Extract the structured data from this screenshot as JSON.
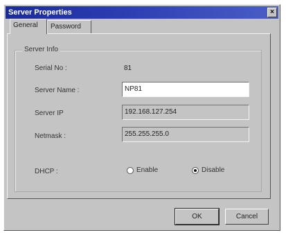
{
  "window": {
    "title": "Server Properties",
    "close_glyph": "×"
  },
  "tabs": [
    {
      "label": "General",
      "selected": true
    },
    {
      "label": "Password",
      "selected": false
    }
  ],
  "server_info": {
    "group_label": "Server Info",
    "serial_label": "Serial No :",
    "serial_value": "81",
    "name_label": "Server Name :",
    "name_value": "NP81",
    "ip_label": "Server IP",
    "ip_value": "192.168.127.254",
    "netmask_label": "Netmask :",
    "netmask_value": "255.255.255.0",
    "dhcp_label": "DHCP :",
    "dhcp_options": [
      {
        "label": "Enable",
        "selected": false
      },
      {
        "label": "Disable",
        "selected": true
      }
    ]
  },
  "buttons": {
    "ok": "OK",
    "cancel": "Cancel"
  },
  "colors": {
    "titlebar": "#1a2a9a",
    "dialog_face": "#c4c4c4"
  }
}
